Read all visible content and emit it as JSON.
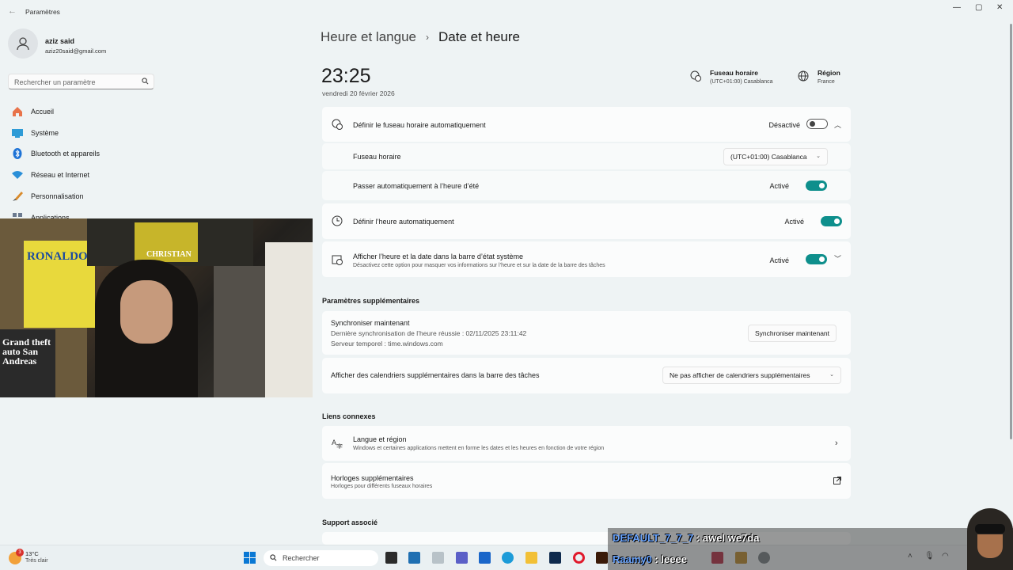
{
  "app": {
    "title": "Paramètres",
    "user_name": "aziz said",
    "user_email": "aziz20said@gmail.com",
    "search_placeholder": "Rechercher un paramètre"
  },
  "nav": [
    {
      "label": "Accueil",
      "icon": "home-icon"
    },
    {
      "label": "Système",
      "icon": "system-icon"
    },
    {
      "label": "Bluetooth et appareils",
      "icon": "bluetooth-icon"
    },
    {
      "label": "Réseau et Internet",
      "icon": "wifi-icon"
    },
    {
      "label": "Personnalisation",
      "icon": "brush-icon"
    },
    {
      "label": "Applications",
      "icon": "apps-icon"
    }
  ],
  "webcam": {
    "poster_texts": [
      "RONALDO",
      "CHRISTIAN",
      "Grand theft auto San Andreas"
    ]
  },
  "breadcrumb": {
    "parent": "Heure et langue",
    "separator": "›",
    "current": "Date et heure"
  },
  "clock": {
    "time": "23:25",
    "date": "vendredi 20 février 2026"
  },
  "header_info": {
    "timezone_title": "Fuseau horaire",
    "timezone_value": "(UTC+01:00) Casablanca",
    "region_title": "Région",
    "region_value": "France"
  },
  "settings": {
    "auto_timezone": {
      "label": "Définir le fuseau horaire automatiquement",
      "status": "Désactivé"
    },
    "timezone": {
      "label": "Fuseau horaire",
      "value": "(UTC+01:00) Casablanca"
    },
    "dst": {
      "label": "Passer automatiquement à l’heure d’été",
      "status": "Activé"
    },
    "auto_time": {
      "label": "Définir l’heure automatiquement",
      "status": "Activé"
    },
    "show_time": {
      "label": "Afficher l’heure et la date dans la barre d’état système",
      "desc": "Désactivez cette option pour masquer vos informations sur l’heure et sur la date de la barre des tâches",
      "status": "Activé"
    }
  },
  "additional": {
    "title": "Paramètres supplémentaires",
    "sync_title": "Synchroniser maintenant",
    "sync_last": "Dernière synchronisation de l’heure réussie : 02/11/2025 23:11:42",
    "sync_server": "Serveur temporel : time.windows.com",
    "sync_button": "Synchroniser maintenant",
    "calendars_label": "Afficher des calendriers supplémentaires dans la barre des tâches",
    "calendars_value": "Ne pas afficher de calendriers supplémentaires"
  },
  "related": {
    "title": "Liens connexes",
    "lang_title": "Langue et région",
    "lang_desc": "Windows et certaines applications mettent en forme les dates et les heures en fonction de votre région",
    "clocks_title": "Horloges supplémentaires",
    "clocks_desc": "Horloges pour différents fuseaux horaires"
  },
  "support": {
    "title": "Support associé"
  },
  "taskbar": {
    "temperature": "13°C",
    "weather": "Très clair",
    "weather_badge": "3",
    "search": "Rechercher"
  },
  "chat": {
    "line1_user": "DEFAULT_7_7_7",
    "line1_msg": " : awel we7da",
    "line2_user": "Raamy0",
    "line2_msg": " : leeee"
  },
  "colors": {
    "accent": "#0e8f8c",
    "background": "#eef3f4",
    "card": "#fbfcfc"
  }
}
